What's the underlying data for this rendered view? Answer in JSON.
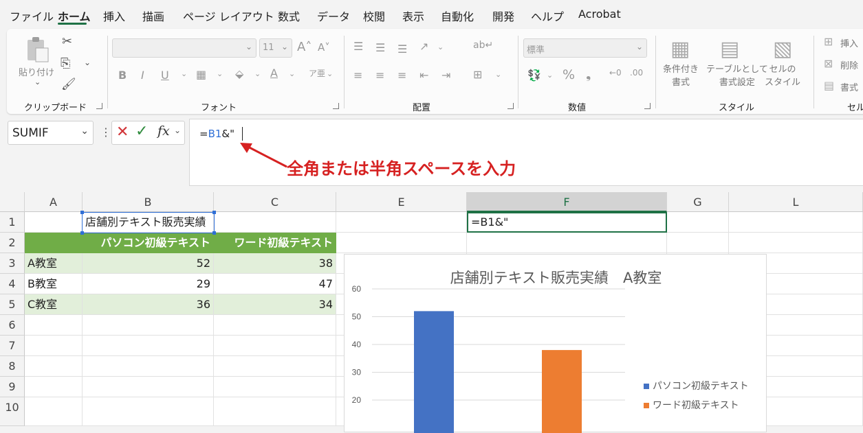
{
  "menu": [
    "ファイル",
    "ホーム",
    "挿入",
    "描画",
    "ページ レイアウト",
    "数式",
    "データ",
    "校閲",
    "表示",
    "自動化",
    "開発",
    "ヘルプ",
    "Acrobat"
  ],
  "ribbon": {
    "clipboard": {
      "paste": "貼り付け",
      "label": "クリップボード"
    },
    "font": {
      "size": "11",
      "label": "フォント"
    },
    "alignment": {
      "label": "配置"
    },
    "number": {
      "format": "標準",
      "label": "数値"
    },
    "styles": {
      "conditional": "条件付き\n書式",
      "table": "テーブルとして\n書式設定",
      "cell": "セルの\nスタイル",
      "label": "スタイル"
    },
    "cells": {
      "insert": "挿入",
      "delete": "削除",
      "format": "書式",
      "label": "セル"
    }
  },
  "namebox": "SUMIF",
  "formula": {
    "prefix": "=",
    "ref": "B1",
    "suffix": "&\""
  },
  "annotation": "全角または半角スペースを入力",
  "columns": [
    "A",
    "B",
    "C",
    "E",
    "F",
    "G",
    "L"
  ],
  "rows": [
    "1",
    "2",
    "3",
    "4",
    "5",
    "6",
    "7",
    "8",
    "9",
    "10"
  ],
  "cells": {
    "b1": "店舗別テキスト販売実績",
    "f1": "=B1&\"",
    "b2": "パソコン初級テキスト",
    "c2": "ワード初級テキスト",
    "a3": "A教室",
    "b3": "52",
    "c3": "38",
    "a4": "B教室",
    "b4": "29",
    "c4": "47",
    "a5": "C教室",
    "b5": "36",
    "c5": "34"
  },
  "chart_data": {
    "type": "bar",
    "title": "店舗別テキスト販売実績　A教室",
    "categories": [
      "A教室"
    ],
    "series": [
      {
        "name": "パソコン初級テキスト",
        "values": [
          52
        ],
        "color": "#4472c4"
      },
      {
        "name": "ワード初級テキスト",
        "values": [
          38
        ],
        "color": "#ed7d31"
      }
    ],
    "yticks": [
      "60",
      "50",
      "40",
      "30",
      "20"
    ],
    "ylim": [
      20,
      60
    ],
    "legend": "right"
  }
}
